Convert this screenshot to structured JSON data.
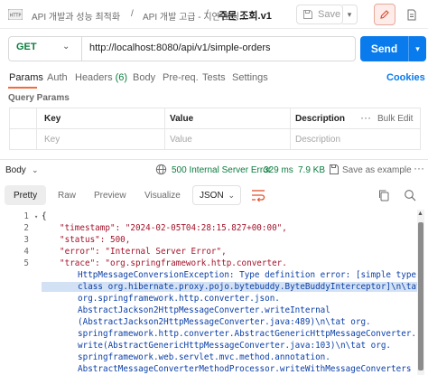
{
  "header": {
    "breadcrumbs": [
      "API 개발과 성능 최적화",
      "API 개발 고급 - 지연 로딩..."
    ],
    "separators": [
      "/",
      "/"
    ],
    "current": "주문 조회.v1",
    "save_label": "Save"
  },
  "request": {
    "method": "GET",
    "url": "http://localhost:8080/api/v1/simple-orders",
    "send_label": "Send"
  },
  "tabs": {
    "items": [
      "Params",
      "Auth",
      "Headers",
      "Body",
      "Pre-req.",
      "Tests",
      "Settings"
    ],
    "headers_count": "(6)",
    "cookies": "Cookies"
  },
  "query_params": {
    "title": "Query Params",
    "columns": [
      "Key",
      "Value",
      "Description"
    ],
    "placeholders": [
      "Key",
      "Value",
      "Description"
    ],
    "bulk_edit": "Bulk Edit"
  },
  "response": {
    "body_label": "Body",
    "status": "500 Internal Server Error",
    "time": "329 ms",
    "size": "7.9 KB",
    "save_example": "Save as example"
  },
  "view": {
    "tabs": [
      "Pretty",
      "Raw",
      "Preview",
      "Visualize"
    ],
    "format": "JSON"
  },
  "code": {
    "line_numbers": [
      "1",
      "2",
      "3",
      "4",
      "5"
    ],
    "lines": [
      "{",
      "\"timestamp\": \"2024-02-05T04:28:15.827+00:00\",",
      "\"status\": 500,",
      "\"error\": \"Internal Server Error\",",
      "\"trace\": \"org.springframework.http.converter.",
      "HttpMessageConversionException: Type definition error: [simple type,",
      "class org.hibernate.proxy.pojo.bytebuddy.ByteBuddyInterceptor]\\n\\tat",
      "org.springframework.http.converter.json.",
      "AbstractJackson2HttpMessageConverter.writeInternal",
      "(AbstractJackson2HttpMessageConverter.java:489)\\n\\tat org.",
      "springframework.http.converter.AbstractGenericHttpMessageConverter.",
      "write(AbstractGenericHttpMessageConverter.java:103)\\n\\tat org.",
      "springframework.web.servlet.mvc.method.annotation.",
      "AbstractMessageConverterMethodProcessor.writeWithMessageConverters"
    ]
  },
  "colors": {
    "accent": "#097bed",
    "get_method": "#0b7d3e",
    "status_text": "#0b7d3e",
    "json_key": "#a3152b",
    "json_string": "#0b3fa7",
    "active_tab_underline": "#f26b3a"
  }
}
